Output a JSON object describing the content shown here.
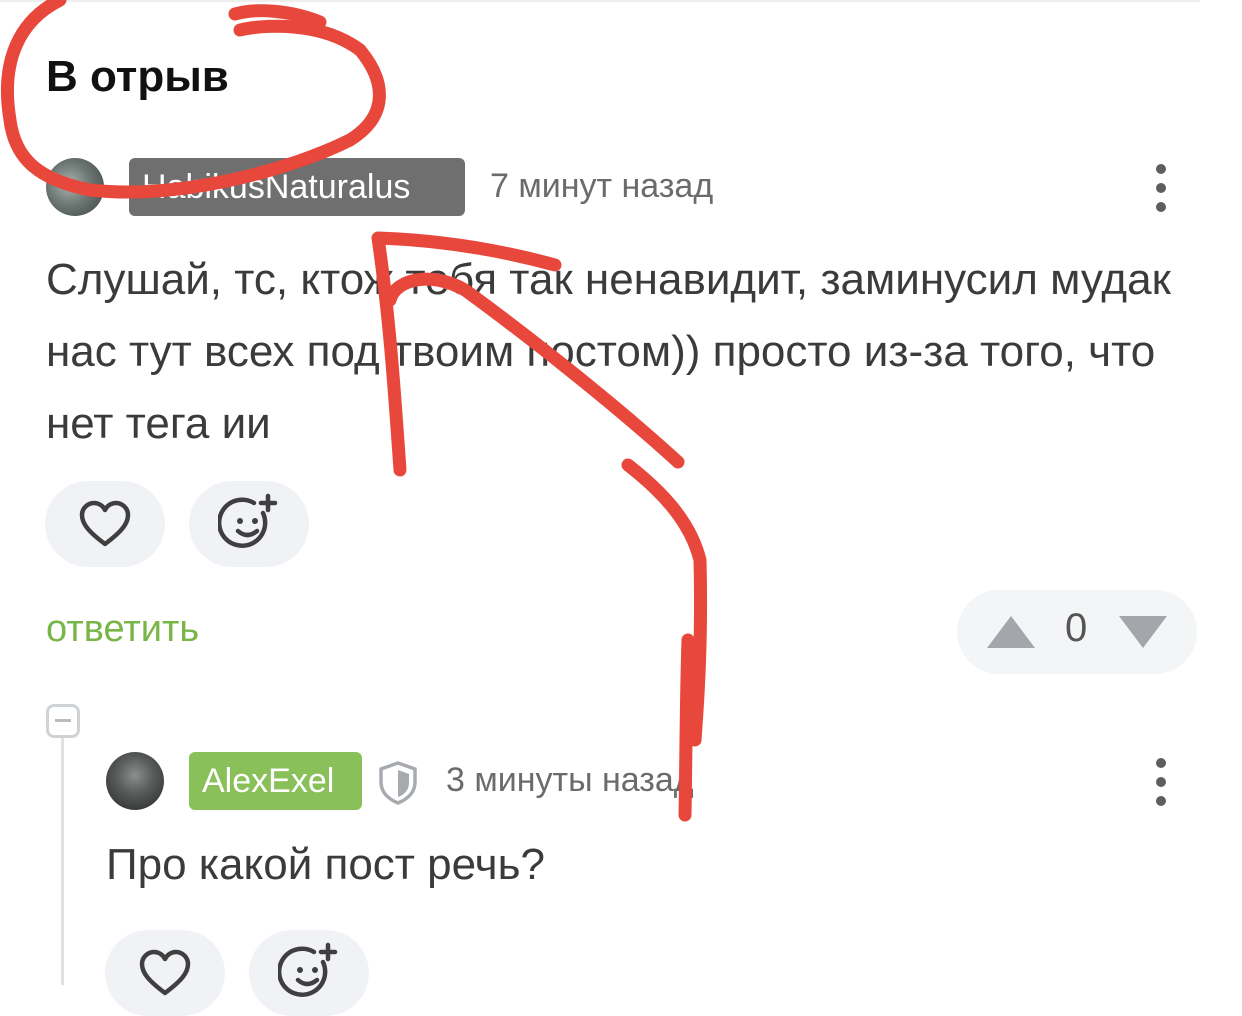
{
  "section": {
    "title": "В отрыв"
  },
  "comments": [
    {
      "author": "HabikusNaturalus",
      "time": "7 минут назад",
      "text": "Слушай, тс, ктож тебя так ненавидит, заминусил мудак нас тут всех под твоим постом)) просто из-за того, что нет тега ии",
      "reply_label": "ответить",
      "rating": "0"
    },
    {
      "author": "AlexExel",
      "time": "3 минуты назад",
      "text": "Про какой пост речь?"
    }
  ],
  "colors": {
    "nick_gray": "#6f6f6f",
    "nick_green": "#8ac05a",
    "reply_green": "#79b648",
    "annotation_red": "#e8473c"
  },
  "icons": [
    "heart-icon",
    "emoji-add-icon",
    "more-vertical-icon",
    "shield-icon",
    "arrow-up-icon",
    "arrow-down-icon",
    "collapse-minus-icon"
  ]
}
